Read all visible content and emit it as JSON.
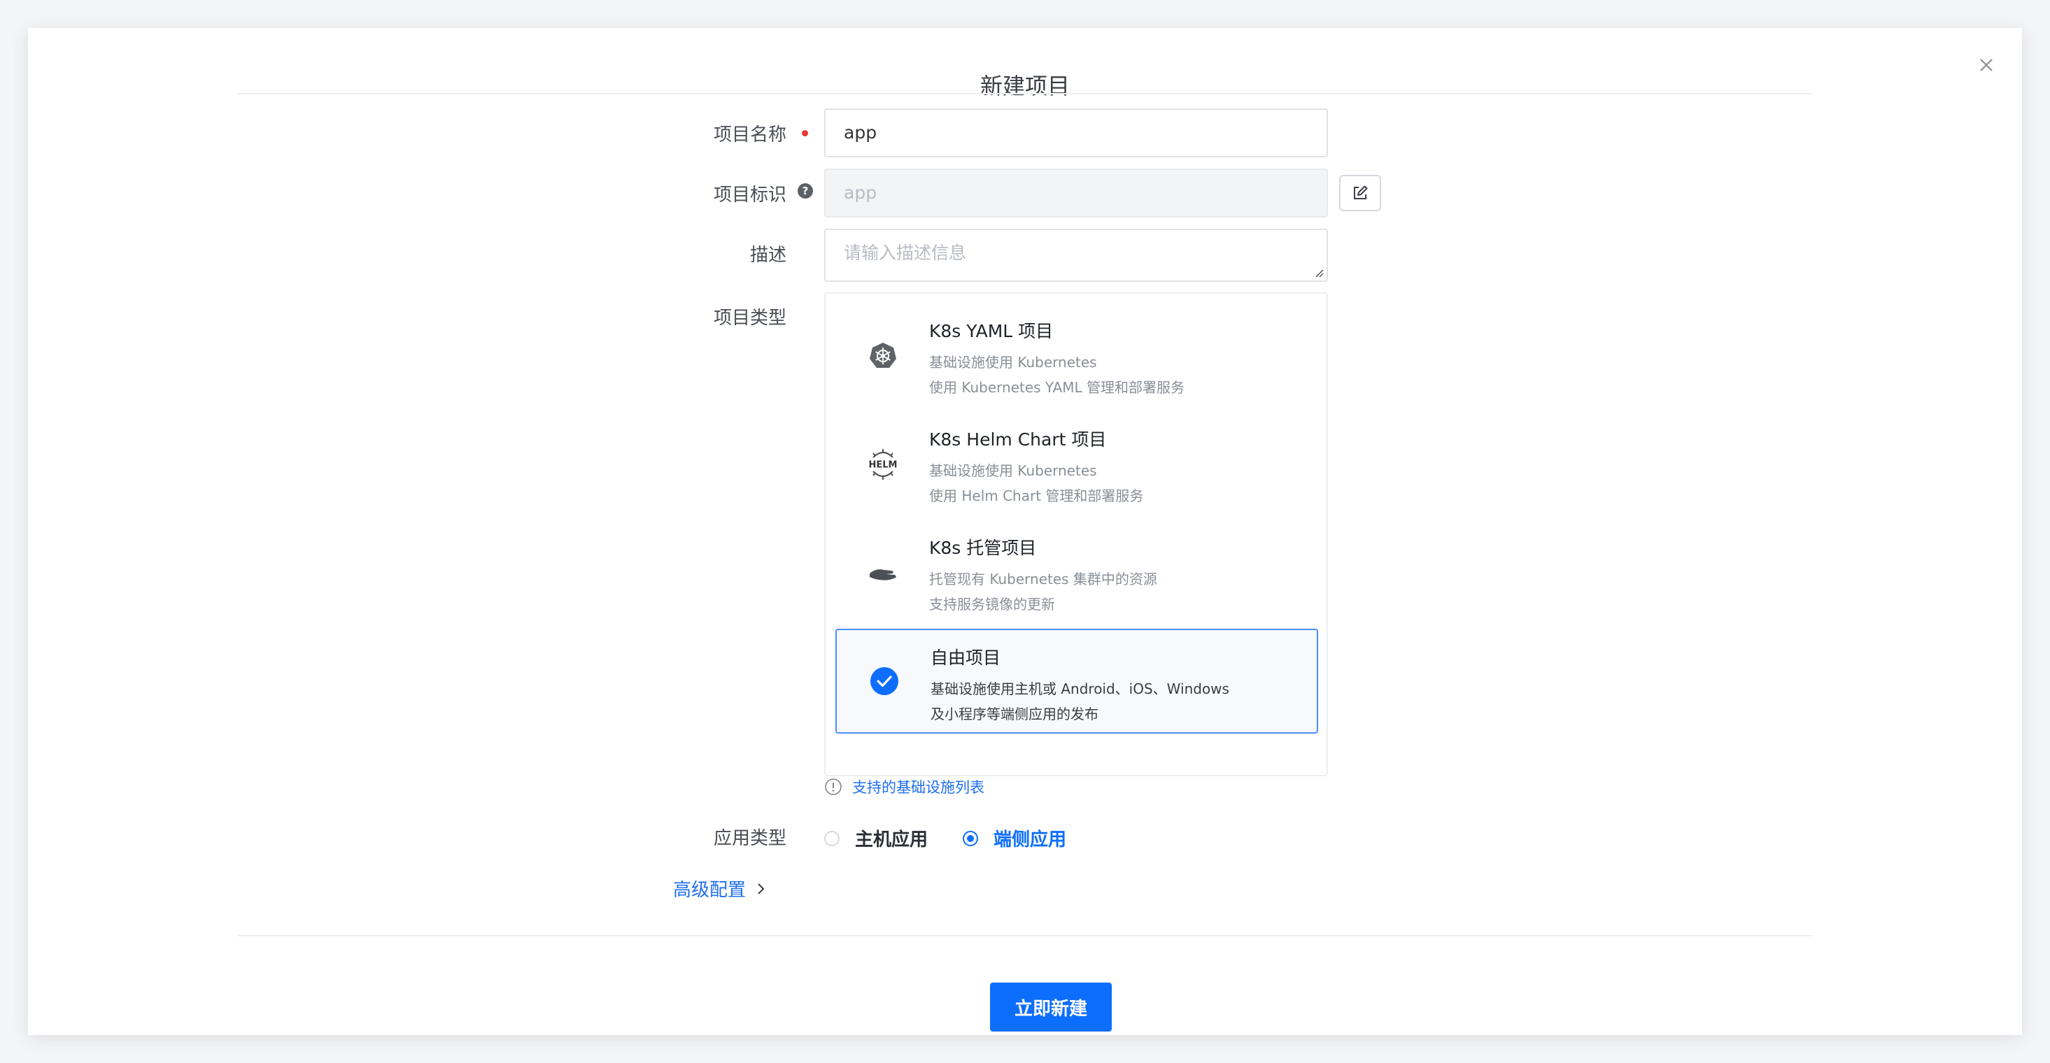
{
  "dialog": {
    "title": "新建项目"
  },
  "form": {
    "name": {
      "label": "项目名称",
      "value": "app"
    },
    "key": {
      "label": "项目标识",
      "value": "app"
    },
    "description": {
      "label": "描述",
      "placeholder": "请输入描述信息"
    },
    "type": {
      "label": "项目类型",
      "options": [
        {
          "title": "K8s YAML 项目",
          "line1": "基础设施使用 Kubernetes",
          "line2": "使用 Kubernetes YAML 管理和部署服务",
          "icon": "kubernetes-icon"
        },
        {
          "title": "K8s Helm Chart 项目",
          "line1": "基础设施使用 Kubernetes",
          "line2": "使用 Helm Chart 管理和部署服务",
          "icon": "helm-icon",
          "icon_text": "HELM"
        },
        {
          "title": "K8s 托管项目",
          "line1": "托管现有 Kubernetes 集群中的资源",
          "line2": "支持服务镜像的更新",
          "icon": "hand-icon"
        },
        {
          "title": "自由项目",
          "line1": "基础设施使用主机或 Android、iOS、Windows",
          "line2": "及小程序等端侧应用的发布",
          "icon": "check-circle-icon",
          "selected": true
        }
      ]
    },
    "infra_hint": "支持的基础设施列表",
    "app_type": {
      "label": "应用类型",
      "options": [
        {
          "label": "主机应用",
          "checked": false
        },
        {
          "label": "端侧应用",
          "checked": true
        }
      ]
    },
    "advanced": "高级配置"
  },
  "footer": {
    "submit": "立即新建"
  },
  "colors": {
    "primary": "#0d6efd",
    "required": "#e83737"
  }
}
